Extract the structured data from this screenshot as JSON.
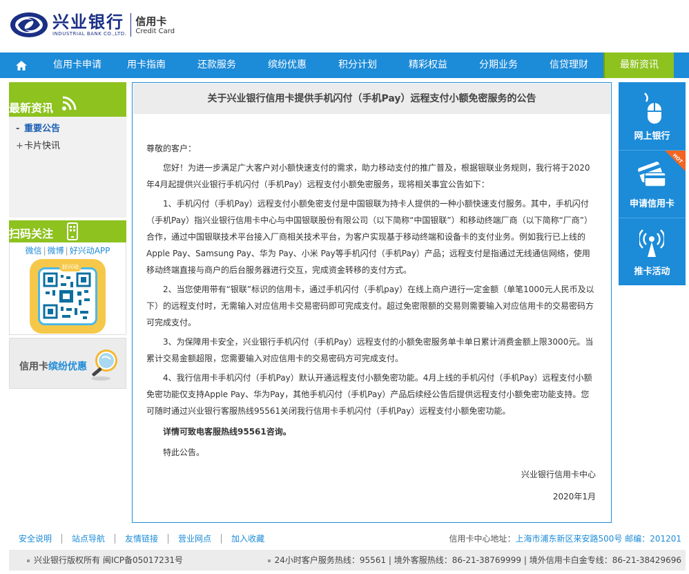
{
  "header": {
    "bank_name": "兴业银行",
    "bank_en": "INDUSTRIAL BANK CO.,LTD.",
    "card_cn": "信用卡",
    "card_en": "Credit Card"
  },
  "nav": {
    "items": [
      {
        "label": "信用卡申请"
      },
      {
        "label": "用卡指南"
      },
      {
        "label": "还款服务"
      },
      {
        "label": "缤纷优惠"
      },
      {
        "label": "积分计划"
      },
      {
        "label": "精彩权益"
      },
      {
        "label": "分期业务"
      },
      {
        "label": "信贷理财"
      },
      {
        "label": "最新资讯"
      }
    ]
  },
  "sidebar": {
    "news_title": "最新资讯",
    "links": [
      {
        "mark": "-",
        "label": "重要公告"
      },
      {
        "mark": "+",
        "label": "卡片快讯"
      }
    ],
    "scan_title": "扫码关注",
    "scan_links": [
      "微信",
      "微博",
      "好兴动APP"
    ],
    "qr_label": "好兴动",
    "promo_prefix": "信用卡",
    "promo_highlight": "缤纷优惠"
  },
  "article": {
    "title": "关于兴业银行信用卡提供手机闪付（手机Pay）远程支付小额免密服务的公告",
    "greeting": "尊敬的客户：",
    "paragraphs": [
      "您好！为进一步满足广大客户对小额快速支付的需求，助力移动支付的推广普及，根据银联业务规则，我行将于2020年4月起提供兴业银行手机闪付（手机Pay）远程支付小额免密服务，现将相关事宜公告如下：",
      "1、手机闪付（手机Pay）远程支付小额免密支付是中国银联为持卡人提供的一种小额快速支付服务。其中，手机闪付（手机Pay）指兴业银行信用卡中心与中国银联股份有限公司（以下简称“中国银联”）和移动终端厂商（以下简称“厂商”）合作，通过中国银联技术平台接入厂商相关技术平台，为客户实现基于移动终端和设备卡的支付业务。例如我行已上线的Apple Pay、Samsung Pay、华为 Pay、小米 Pay等手机闪付（手机Pay）产品；远程支付是指通过无线通信网络，使用移动终端直接与商户的后台服务器进行交互，完成资金转移的支付方式。",
      "2、当您使用带有“银联”标识的信用卡，通过手机闪付（手机pay）在线上商户进行一定金额（单笔1000元人民币及以下）的远程支付时，无需输入对应信用卡交易密码即可完成支付。超过免密限额的交易则需要输入对应信用卡的交易密码方可完成支付。",
      "3、为保障用卡安全，兴业银行手机闪付（手机Pay）远程支付的小额免密服务单卡单日累计消费金额上限3000元。当累计交易金额超限，您需要输入对应信用卡的交易密码方可完成支付。",
      "4、我行信用卡手机闪付（手机Pay）默认开通远程支付小额免密功能。4月上线的手机闪付（手机Pay）远程支付小额免密功能仅支持Apple Pay、华为Pay，其他手机闪付（手机Pay）产品后续经公告后提供远程支付小额免密功能支持。您可随时通过兴业银行客服热线95561关闭我行信用卡手机闪付（手机Pay）远程支付小额免密功能。"
    ],
    "hotline_note": "详情可致电客服热线95561咨询。",
    "closing": "特此公告。",
    "signature": "兴业银行信用卡中心",
    "date": "2020年1月"
  },
  "right_panel": {
    "items": [
      {
        "label": "网上银行"
      },
      {
        "label": "申请信用卡"
      },
      {
        "label": "推卡活动"
      }
    ],
    "hot_badge": "HOT"
  },
  "footer": {
    "links": [
      "安全说明",
      "站点导航",
      "友情链接",
      "营业网点",
      "加入收藏"
    ],
    "address_label": "信用卡中心地址：",
    "address": "上海市浦东新区来安路500号 邮编：201201",
    "copyright": "兴业银行版权所有 闽ICP备05017231号",
    "hotlines": "24小时客户服务热线：95561 | 境外客服热线：86-21-38769999 | 境外信用卡白金专线：86-21-38429696"
  },
  "colors": {
    "brand_blue": "#1c8bd8",
    "accent_green": "#8dc21f",
    "logo_navy": "#1a2f85"
  }
}
